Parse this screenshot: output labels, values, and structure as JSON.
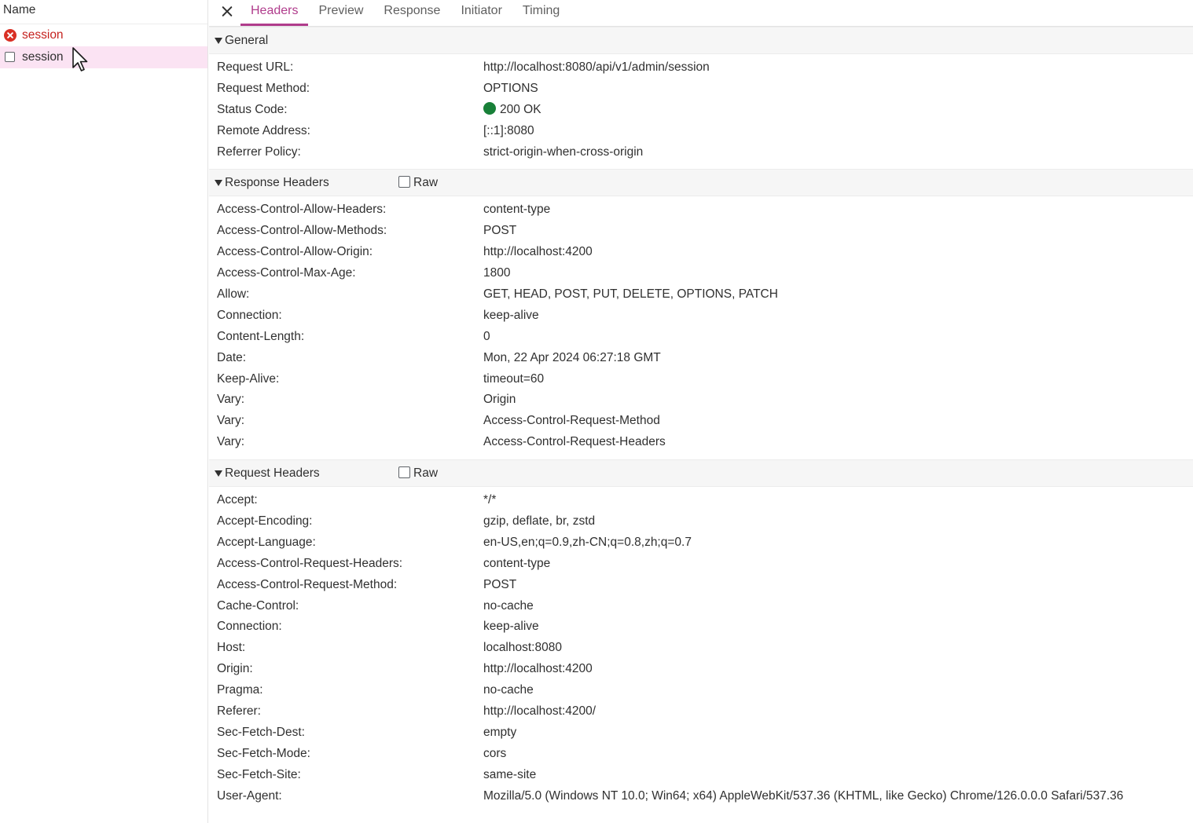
{
  "request_list": {
    "header": "Name",
    "items": [
      {
        "name": "session",
        "state": "error",
        "icon": "error-icon"
      },
      {
        "name": "session",
        "state": "selected",
        "icon": "document-icon"
      }
    ]
  },
  "tabs": [
    "Headers",
    "Preview",
    "Response",
    "Initiator",
    "Timing"
  ],
  "active_tab": "Headers",
  "colors": {
    "accent": "#b03c8c",
    "error": "#d93025",
    "success": "#188038",
    "selected_row": "#fbe3f3"
  },
  "general": {
    "title": "General",
    "rows": [
      {
        "k": "Request URL:",
        "v": "http://localhost:8080/api/v1/admin/session"
      },
      {
        "k": "Request Method:",
        "v": "OPTIONS"
      },
      {
        "k": "Status Code:",
        "v": "200 OK"
      },
      {
        "k": "Remote Address:",
        "v": "[::1]:8080"
      },
      {
        "k": "Referrer Policy:",
        "v": "strict-origin-when-cross-origin"
      }
    ]
  },
  "response_headers": {
    "title": "Response Headers",
    "raw_label": "Raw",
    "rows": [
      {
        "k": "Access-Control-Allow-Headers:",
        "v": "content-type"
      },
      {
        "k": "Access-Control-Allow-Methods:",
        "v": "POST"
      },
      {
        "k": "Access-Control-Allow-Origin:",
        "v": "http://localhost:4200"
      },
      {
        "k": "Access-Control-Max-Age:",
        "v": "1800"
      },
      {
        "k": "Allow:",
        "v": "GET, HEAD, POST, PUT, DELETE, OPTIONS, PATCH"
      },
      {
        "k": "Connection:",
        "v": "keep-alive"
      },
      {
        "k": "Content-Length:",
        "v": "0"
      },
      {
        "k": "Date:",
        "v": "Mon, 22 Apr 2024 06:27:18 GMT"
      },
      {
        "k": "Keep-Alive:",
        "v": "timeout=60"
      },
      {
        "k": "Vary:",
        "v": "Origin"
      },
      {
        "k": "Vary:",
        "v": "Access-Control-Request-Method"
      },
      {
        "k": "Vary:",
        "v": "Access-Control-Request-Headers"
      }
    ]
  },
  "request_headers": {
    "title": "Request Headers",
    "raw_label": "Raw",
    "rows": [
      {
        "k": "Accept:",
        "v": "*/*"
      },
      {
        "k": "Accept-Encoding:",
        "v": "gzip, deflate, br, zstd"
      },
      {
        "k": "Accept-Language:",
        "v": "en-US,en;q=0.9,zh-CN;q=0.8,zh;q=0.7"
      },
      {
        "k": "Access-Control-Request-Headers:",
        "v": "content-type"
      },
      {
        "k": "Access-Control-Request-Method:",
        "v": "POST"
      },
      {
        "k": "Cache-Control:",
        "v": "no-cache"
      },
      {
        "k": "Connection:",
        "v": "keep-alive"
      },
      {
        "k": "Host:",
        "v": "localhost:8080"
      },
      {
        "k": "Origin:",
        "v": "http://localhost:4200"
      },
      {
        "k": "Pragma:",
        "v": "no-cache"
      },
      {
        "k": "Referer:",
        "v": "http://localhost:4200/"
      },
      {
        "k": "Sec-Fetch-Dest:",
        "v": "empty"
      },
      {
        "k": "Sec-Fetch-Mode:",
        "v": "cors"
      },
      {
        "k": "Sec-Fetch-Site:",
        "v": "same-site"
      },
      {
        "k": "User-Agent:",
        "v": "Mozilla/5.0 (Windows NT 10.0; Win64; x64) AppleWebKit/537.36 (KHTML, like Gecko) Chrome/126.0.0.0 Safari/537.36"
      }
    ]
  }
}
